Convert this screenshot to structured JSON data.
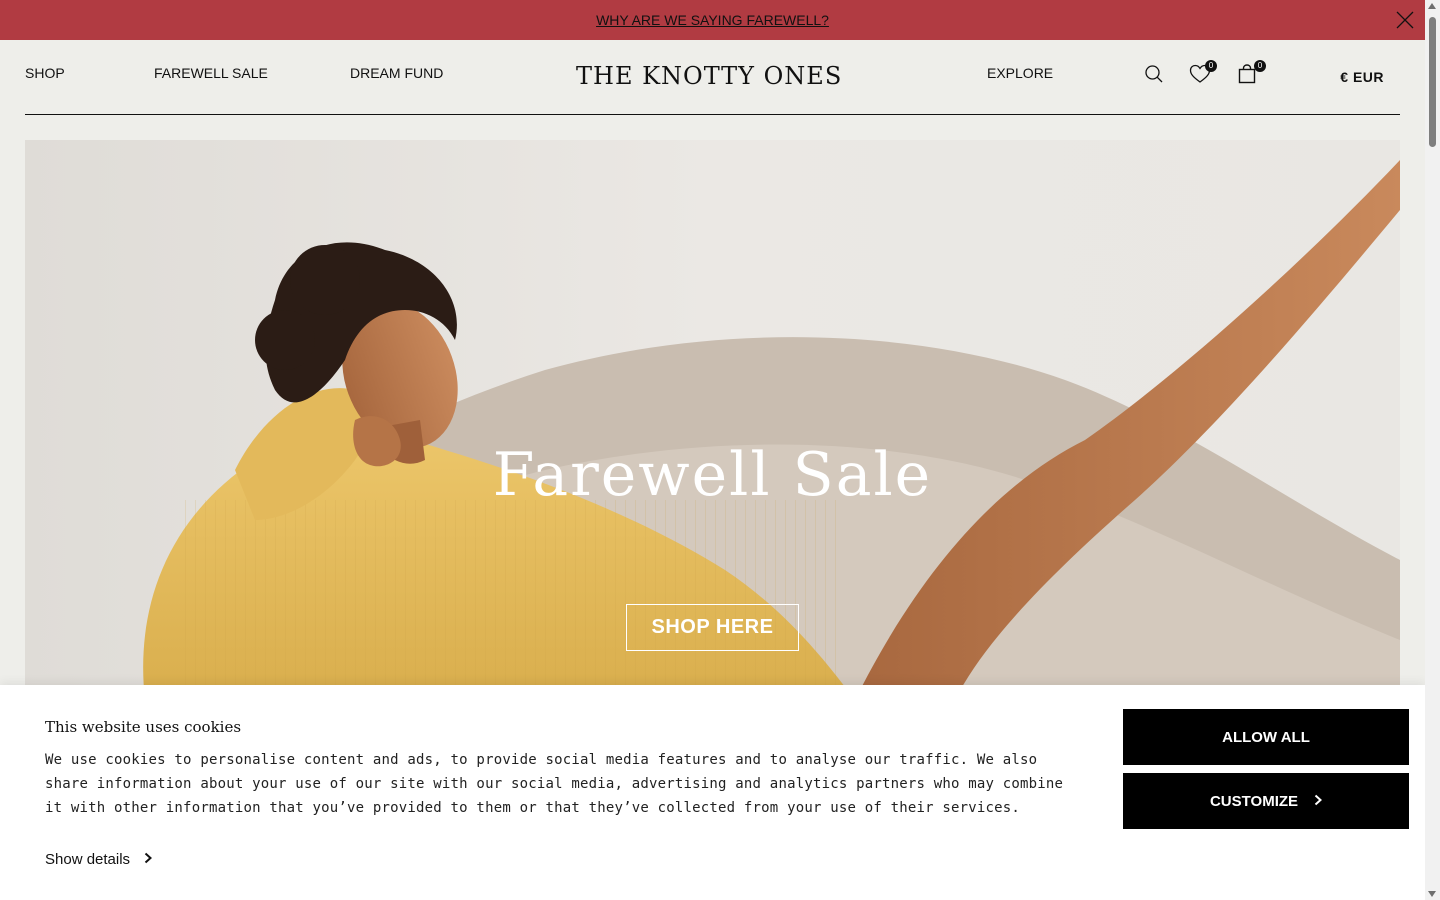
{
  "announcement": {
    "link_text": "WHY ARE WE SAYING FAREWELL?",
    "close_icon": "close-icon",
    "bg_color": "#b13b42"
  },
  "header": {
    "nav_left": [
      {
        "label": "SHOP"
      },
      {
        "label": "FAREWELL SALE"
      },
      {
        "label": "DREAM FUND"
      }
    ],
    "logo": "THE KNOTTY ONES",
    "nav_right": [
      {
        "label": "EXPLORE"
      }
    ],
    "icons": {
      "search": "search-icon",
      "wishlist": "heart-icon",
      "wishlist_count": "0",
      "cart": "bag-icon",
      "cart_count": "0"
    },
    "currency": "€ EUR"
  },
  "hero": {
    "title": "Farewell Sale",
    "button_label": "SHOP HERE"
  },
  "cookie_banner": {
    "title": "This website uses cookies",
    "text": "We use cookies to personalise content and ads, to provide social media features and to analyse our traffic. We also share information about your use of our site with our social media, advertising and analytics partners who may combine it with other information that you’ve provided to them or that they’ve collected from your use of their services.",
    "show_details": "Show details",
    "allow_all": "ALLOW ALL",
    "customize": "CUSTOMIZE"
  }
}
